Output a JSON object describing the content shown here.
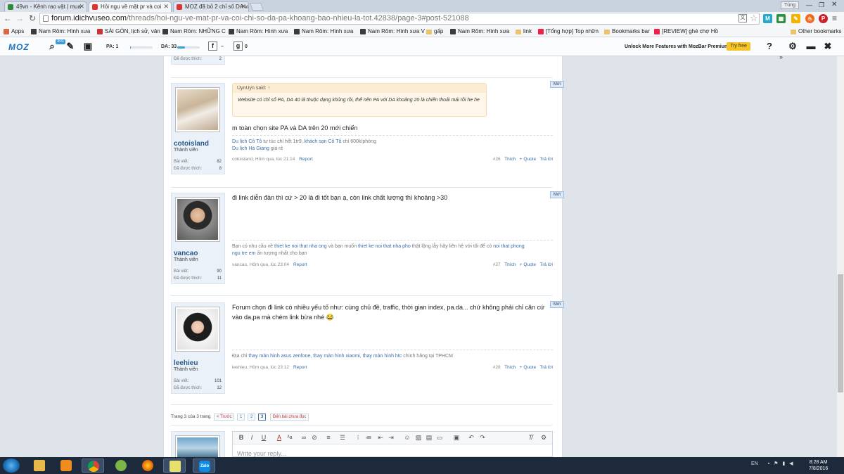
{
  "browser": {
    "tabs": [
      {
        "label": "49vn - Kênh rao vặt | mua",
        "fav": "#2e8b3a"
      },
      {
        "label": "Hỏi ngu về mặt pr và coi",
        "fav": "#d33"
      },
      {
        "label": "MOZ đã bỏ 2 chỉ số DA và",
        "fav": "#d33"
      }
    ],
    "user": "Tùng",
    "url_domain": "forum.idichvuseo.com",
    "url_path": "/threads/hoi-ngu-ve-mat-pr-va-coi-chi-so-da-pa-khoang-bao-nhieu-la-tot.42838/page-3#post-521088"
  },
  "bookmarks": [
    {
      "label": "Apps",
      "icon": "apps"
    },
    {
      "label": "Nam Rôm: Hình xưa",
      "icon": "page"
    },
    {
      "label": "SÀI GÒN, lịch sử, văn",
      "icon": "page"
    },
    {
      "label": "Nam Rôm: NHỮNG C",
      "icon": "page"
    },
    {
      "label": "Nam Rôm: Hình xưa",
      "icon": "page"
    },
    {
      "label": "Nam Rôm: Hình xưa",
      "icon": "page"
    },
    {
      "label": "Nam Rôm: Hình xưa V",
      "icon": "page"
    },
    {
      "label": "gấp",
      "icon": "folder"
    },
    {
      "label": "Nam Rôm: Hình xưa",
      "icon": "page"
    },
    {
      "label": "link",
      "icon": "folder"
    },
    {
      "label": "[Tổng hợp] Top nhữn",
      "icon": "page"
    },
    {
      "label": "Bookmarks bar",
      "icon": "folder"
    },
    {
      "label": "[REVIEW] ghé chợ Hồ",
      "icon": "page"
    },
    {
      "label": "Other bookmarks",
      "icon": "folder"
    }
  ],
  "moz": {
    "logo": "MOZ",
    "badge": "301",
    "pa_label": "PA: 1",
    "pa_fill": 0.01,
    "da_label": "DA: 33",
    "da_fill": 0.33,
    "fb_count": "–",
    "gplus_count": "0",
    "premium": "Unlock More Features with MozBar Premium",
    "try_free": "Try free"
  },
  "prev_post": {
    "likes_label": "Đã được thích:",
    "likes": "2"
  },
  "posts": [
    {
      "username": "cotoisland",
      "title": "Thành viên",
      "posts_label": "Bài viết:",
      "posts": "82",
      "likes_label": "Đã được thích:",
      "likes": "8",
      "quote_header": "UynUyn said: ↑",
      "quote_body": "Website có chỉ số PA, DA 40 là thuộc dạng khủng rồi, thế nên PA với DA khoảng 20 là chiến thoải mái rồi he he",
      "message": "m toàn chọn site PA và DA trên 20 mới chiến",
      "sig_parts": [
        {
          "t": "Du lịch Cô Tô",
          "l": true
        },
        {
          "t": " tự túc chỉ hết 1tr9, ",
          "l": false
        },
        {
          "t": "khách sạn Cô Tô",
          "l": true
        },
        {
          "t": " chỉ 600k/phòng",
          "l": false
        }
      ],
      "sig_line2": [
        {
          "t": "Du lịch Hà Giang",
          "l": true
        },
        {
          "t": " giá rẻ",
          "l": false
        }
      ],
      "meta": "cotoisland, Hôm qua, lúc 21:14",
      "report": "Report",
      "num": "#26",
      "like": "Thích",
      "quote": "+ Quote",
      "reply": "Trả lời",
      "new": "Mới"
    },
    {
      "username": "vancao",
      "title": "Thành viên",
      "posts_label": "Bài viết:",
      "posts": "90",
      "likes_label": "Đã được thích:",
      "likes": "11",
      "message": "đi link diễn đàn thì cứ > 20 là đi tốt bạn ạ, còn link chất lượng thì khoảng >30",
      "sig_parts": [
        {
          "t": "Bạn có nhu cầu về ",
          "l": false
        },
        {
          "t": "thiet ke noi that nha ong",
          "l": true
        },
        {
          "t": " và bạn muốn ",
          "l": false
        },
        {
          "t": "thiet ke noi that nha pho",
          "l": true
        },
        {
          "t": " thật lộng lẫy hãy liên hệ với tôi để có ",
          "l": false
        },
        {
          "t": "noi that phong",
          "l": true
        }
      ],
      "sig_line2": [
        {
          "t": "ngu tre em",
          "l": true
        },
        {
          "t": " ấn tượng nhất cho bạn",
          "l": false
        }
      ],
      "meta": "vancao, Hôm qua, lúc 23:04",
      "report": "Report",
      "num": "#27",
      "like": "Thích",
      "quote": "+ Quote",
      "reply": "Trả lời",
      "new": "Mới"
    },
    {
      "username": "leehieu",
      "title": "Thành viên",
      "posts_label": "Bài viết:",
      "posts": "101",
      "likes_label": "Đã được thích:",
      "likes": "12",
      "message_l1": "Forum chọn đi link có nhiều yếu tố như: cùng chủ đề, traffic, thời gian index, pa.da... chứ không phải chỉ căn cứ",
      "message_l2": "vào da,pa mà chém link bừa nhé 😂",
      "sig_parts": [
        {
          "t": "Địa chỉ ",
          "l": false
        },
        {
          "t": "thay màn hình asus zenfone",
          "l": true
        },
        {
          "t": ", ",
          "l": false
        },
        {
          "t": "thay màn hình xiaomi",
          "l": true
        },
        {
          "t": ", ",
          "l": false
        },
        {
          "t": "thay màn hình htc",
          "l": true
        },
        {
          "t": " chính hãng tại TPHCM",
          "l": false
        }
      ],
      "sig_line2": [],
      "meta": "leehieu, Hôm qua, lúc 23:12",
      "report": "Report",
      "num": "#28",
      "like": "Thích",
      "quote": "+ Quote",
      "reply": "Trả lời",
      "new": "Mới"
    }
  ],
  "pagination": {
    "label": "Trang 3 của 3 trang",
    "prev": "< Trước",
    "pages": [
      "1",
      "2",
      "3"
    ],
    "unread": "Đến bài chưa đọc"
  },
  "editor": {
    "placeholder": "Write your reply..."
  },
  "taskbar": {
    "lang": "EN",
    "time": "8:28 AM",
    "date": "7/8/2016",
    "zalo": "Zalo"
  }
}
